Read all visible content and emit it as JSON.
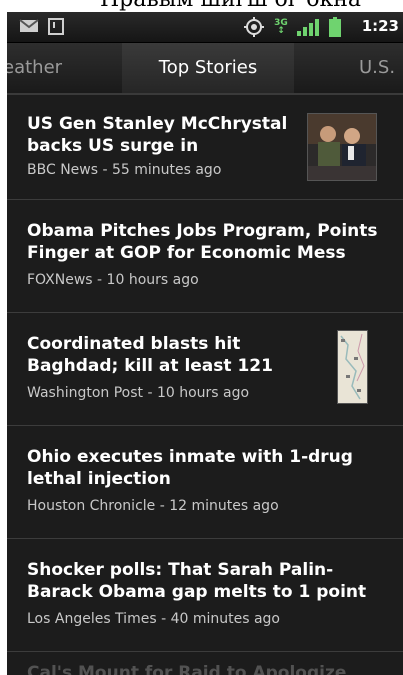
{
  "caption": "Нравым шигш ог окна",
  "statusbar": {
    "time": "1:23",
    "network_label": "3G",
    "icons": [
      "gmail-icon",
      "sdcard-icon",
      "gps-icon",
      "network-3g-icon",
      "signal-icon",
      "battery-icon"
    ]
  },
  "tabs": [
    {
      "label": "eather"
    },
    {
      "label": "Top Stories",
      "active": true
    },
    {
      "label": "U.S."
    }
  ],
  "stories": [
    {
      "headline": "US Gen Stanley McChrystal backs US surge in",
      "source": "BBC News - 55 minutes ago",
      "thumb": "photo"
    },
    {
      "headline": "Obama Pitches Jobs Program, Points Finger at GOP for Economic Mess",
      "source": "FOXNews - 10 hours ago"
    },
    {
      "headline": "Coordinated blasts hit Baghdad; kill at least 121",
      "source": "Washington Post - 10 hours ago",
      "thumb": "map"
    },
    {
      "headline": "Ohio executes inmate with 1-drug lethal injection",
      "source": "Houston Chronicle - 12 minutes ago"
    },
    {
      "headline": "Shocker polls: That Sarah Palin-Barack Obama gap melts to 1 point",
      "source": "Los Angeles Times - 40 minutes ago"
    },
    {
      "headline": "Cal's Mount for Raid to Apologize"
    }
  ],
  "colors": {
    "background": "#1c1c1c",
    "text": "#ffffff",
    "meta": "#c8c8c8",
    "divider": "#3c3c3c"
  }
}
